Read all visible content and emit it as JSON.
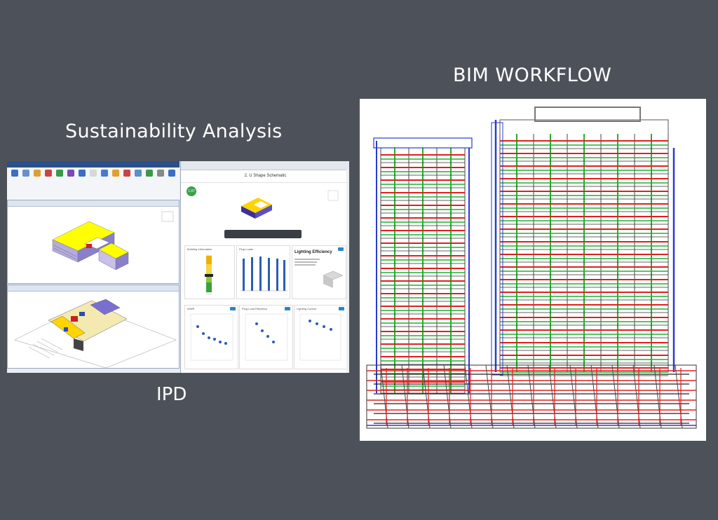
{
  "titles": {
    "sustainability": "Sustainability Analysis",
    "ipd": "IPD",
    "bim": "BIM WORKFLOW"
  },
  "left_panel": {
    "web_header": "2. U Shape Schematic",
    "badge": "1.97",
    "cards": [
      "Building Information",
      "Plug Loads",
      "Lighting Efficiency",
      "WWR",
      "Plug Load Efficiency",
      "Lighting Control"
    ]
  },
  "colors": {
    "background": "#4d525a",
    "building_roof": "#ffff00",
    "building_walls": "#8a7fc9",
    "pipes_red": "#e02020",
    "pipes_green": "#20b030",
    "pipes_blue": "#2a3bd0"
  }
}
